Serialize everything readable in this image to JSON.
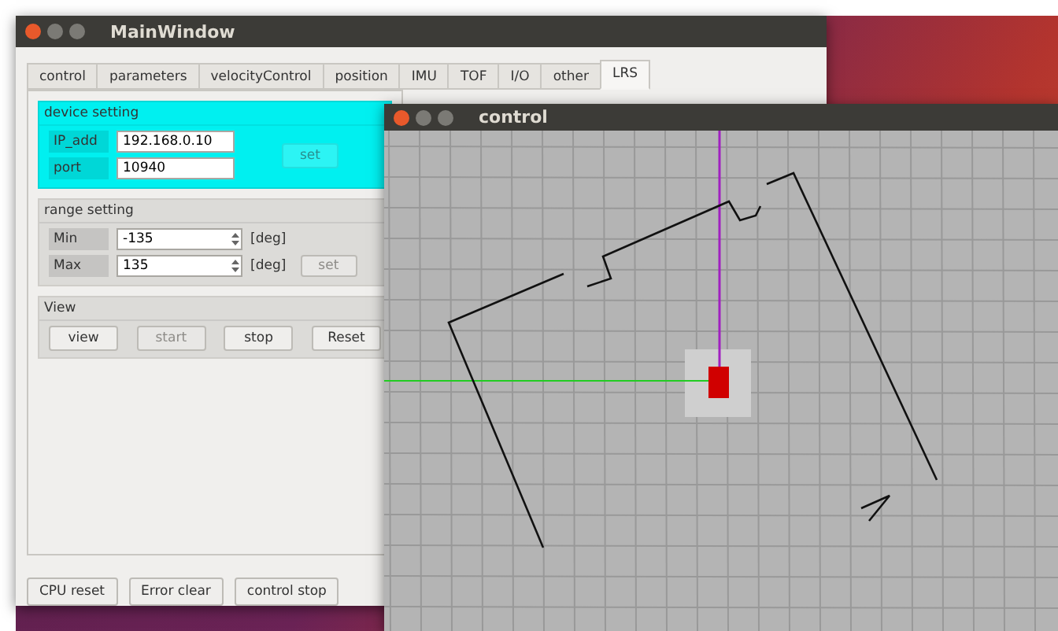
{
  "main_window": {
    "title": "MainWindow",
    "tabs": [
      {
        "label": "control",
        "selected": false
      },
      {
        "label": "parameters",
        "selected": false
      },
      {
        "label": "velocityControl",
        "selected": false
      },
      {
        "label": "position",
        "selected": false
      },
      {
        "label": "IMU",
        "selected": false
      },
      {
        "label": "TOF",
        "selected": false
      },
      {
        "label": "I/O",
        "selected": false
      },
      {
        "label": "other",
        "selected": false
      },
      {
        "label": "LRS",
        "selected": true
      }
    ],
    "device_setting": {
      "title": "device setting",
      "fields": [
        {
          "label": "IP_add",
          "value": "192.168.0.10"
        },
        {
          "label": "port",
          "value": "10940"
        }
      ],
      "set_button": {
        "label": "set",
        "disabled": true
      }
    },
    "range_setting": {
      "title": "range setting",
      "fields": [
        {
          "label": "Min",
          "value": "-135",
          "unit": "[deg]"
        },
        {
          "label": "Max",
          "value": "135",
          "unit": "[deg]"
        }
      ],
      "set_button": {
        "label": "set",
        "disabled": true
      }
    },
    "view": {
      "title": "View",
      "buttons": [
        {
          "label": "view",
          "disabled": false
        },
        {
          "label": "start",
          "disabled": true
        },
        {
          "label": "stop",
          "disabled": false
        },
        {
          "label": "Reset",
          "disabled": false
        }
      ]
    },
    "bottom_buttons": [
      "CPU reset",
      "Error clear",
      "control stop"
    ]
  },
  "control_window": {
    "title": "control"
  }
}
